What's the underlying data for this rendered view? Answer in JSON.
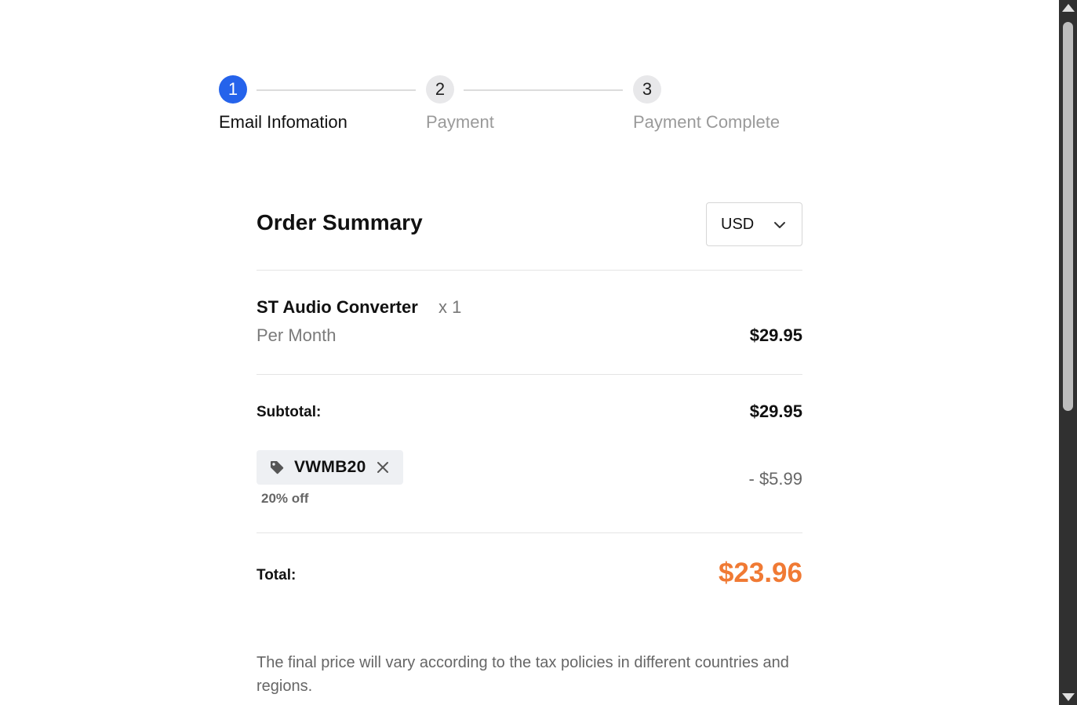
{
  "stepper": {
    "steps": [
      {
        "number": "1",
        "label": "Email Infomation",
        "state": "active"
      },
      {
        "number": "2",
        "label": "Payment",
        "state": "inactive"
      },
      {
        "number": "3",
        "label": "Payment Complete",
        "state": "inactive"
      }
    ],
    "active_color": "#2563eb"
  },
  "order_summary": {
    "title": "Order Summary",
    "currency": {
      "selected": "USD",
      "icon": "chevron-down-icon"
    },
    "product": {
      "name": "ST Audio Converter",
      "quantity": "x 1",
      "period": "Per Month",
      "price": "$29.95"
    },
    "subtotal": {
      "label": "Subtotal:",
      "value": "$29.95"
    },
    "coupon": {
      "code": "VWMB20",
      "description": "20% off",
      "discount": "- $5.99",
      "icons": [
        "tag-icon",
        "close-icon"
      ]
    },
    "total": {
      "label": "Total:",
      "value": "$23.96",
      "color": "#f07a34"
    }
  },
  "tax_note": "The final price will vary according to the tax policies in different countries and regions."
}
